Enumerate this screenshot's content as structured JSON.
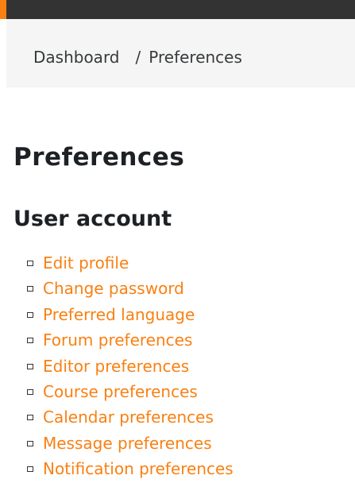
{
  "breadcrumb": {
    "items": [
      "Dashboard",
      "Preferences"
    ],
    "separator": "/"
  },
  "page": {
    "title": "Preferences"
  },
  "user_account": {
    "heading": "User account",
    "links": [
      "Edit profile",
      "Change password",
      "Preferred language",
      "Forum preferences",
      "Editor preferences",
      "Course preferences",
      "Calendar preferences",
      "Message preferences",
      "Notification preferences"
    ]
  },
  "colors": {
    "link": "#f98012",
    "topbar": "#333333",
    "breadcrumb_bg": "#f5f5f5",
    "heading": "#1d2125"
  }
}
